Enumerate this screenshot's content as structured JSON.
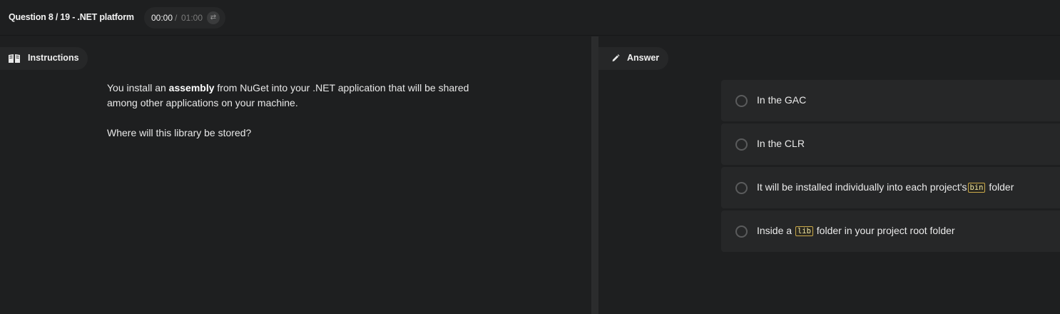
{
  "header": {
    "question_title": "Question 8 / 19 - .NET platform",
    "timer_current": "00:00",
    "timer_separator": "/",
    "timer_total": "01:00",
    "timer_icon": "swap-icon"
  },
  "instructions": {
    "tab_label": "Instructions",
    "tab_icon": "book-icon",
    "text_before": "You install an ",
    "text_bold": "assembly",
    "text_after": " from NuGet into your .NET application that will be shared among other applications on your machine.",
    "question": "Where will this library be stored?"
  },
  "answer": {
    "tab_label": "Answer",
    "tab_icon": "pencil-icon",
    "options": [
      {
        "before": "In the GAC",
        "code": "",
        "after": ""
      },
      {
        "before": "In the CLR",
        "code": "",
        "after": ""
      },
      {
        "before": "It will be installed individually into each project's",
        "code": "bin",
        "after": " folder"
      },
      {
        "before": "Inside a ",
        "code": "lib",
        "after": " folder in your project root folder"
      }
    ]
  },
  "colors": {
    "background": "#1e1f20",
    "panel": "#262728",
    "code_border": "#c9a84a"
  }
}
